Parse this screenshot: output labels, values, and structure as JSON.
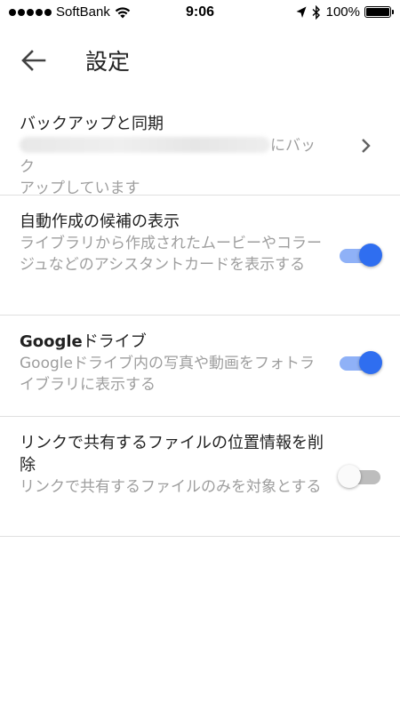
{
  "status_bar": {
    "carrier": "SoftBank",
    "time": "9:06",
    "battery": "100%"
  },
  "app_bar": {
    "title": "設定",
    "back_icon": "arrow-back-icon"
  },
  "settings": {
    "backup": {
      "title": "バックアップと同期",
      "desc_suffix": "にバック",
      "desc_line2": "アップしています"
    },
    "suggestions": {
      "title": "自動作成の候補の表示",
      "desc": "ライブラリから作成されたムービーやコラージュなどのアシスタントカードを表示する",
      "enabled": true
    },
    "drive": {
      "title_bold": "Google",
      "title_rest": "ドライブ",
      "desc": "Googleドライブ内の写真や動画をフォトライブラリに表示する",
      "enabled": true
    },
    "location": {
      "title": "リンクで共有するファイルの位置情報を削除",
      "desc": "リンクで共有するファイルのみを対象とする",
      "enabled": false
    }
  },
  "colors": {
    "accent": "#2f6ef0",
    "accent_track": "#8fb1f7",
    "secondary_text": "#9e9e9e",
    "divider": "#e0e0e0"
  }
}
